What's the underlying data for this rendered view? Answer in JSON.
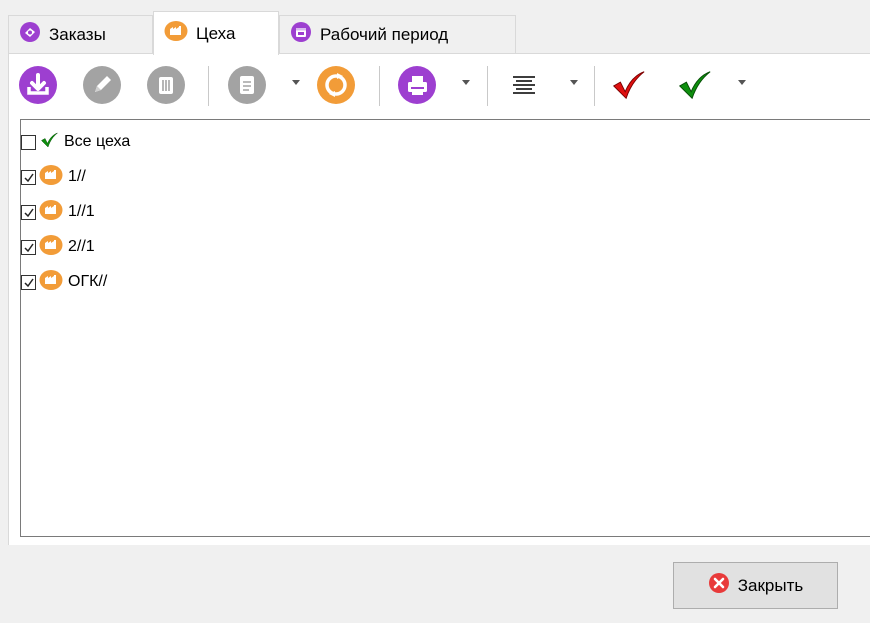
{
  "tabs": [
    {
      "label": "Заказы",
      "icon": "orders-icon",
      "active": false
    },
    {
      "label": "Цеха",
      "icon": "workshop-icon",
      "active": true
    },
    {
      "label": "Рабочий период",
      "icon": "calendar-icon",
      "active": false
    }
  ],
  "toolbar": {
    "buttons": [
      "download-icon",
      "edit-icon",
      "delete-icon",
      "document-icon",
      "refresh-icon",
      "print-icon",
      "align-icon",
      "uncheck-all-icon",
      "check-all-icon"
    ]
  },
  "list": {
    "items": [
      {
        "label": "Все цеха",
        "checked": false,
        "icon": "green-check-icon"
      },
      {
        "label": "1//",
        "checked": true,
        "icon": "workshop-icon"
      },
      {
        "label": "1//1",
        "checked": true,
        "icon": "workshop-icon"
      },
      {
        "label": "2//1",
        "checked": true,
        "icon": "workshop-icon"
      },
      {
        "label": "ОГК//",
        "checked": true,
        "icon": "workshop-icon"
      }
    ]
  },
  "footer": {
    "close_label": "Закрыть"
  },
  "colors": {
    "accent_purple": "#9d3fd0",
    "accent_orange": "#f29c38",
    "disabled_gray": "#a3a3a3",
    "check_red": "#e01010",
    "check_green": "#0e8f0e",
    "close_red": "#e83a3a"
  }
}
